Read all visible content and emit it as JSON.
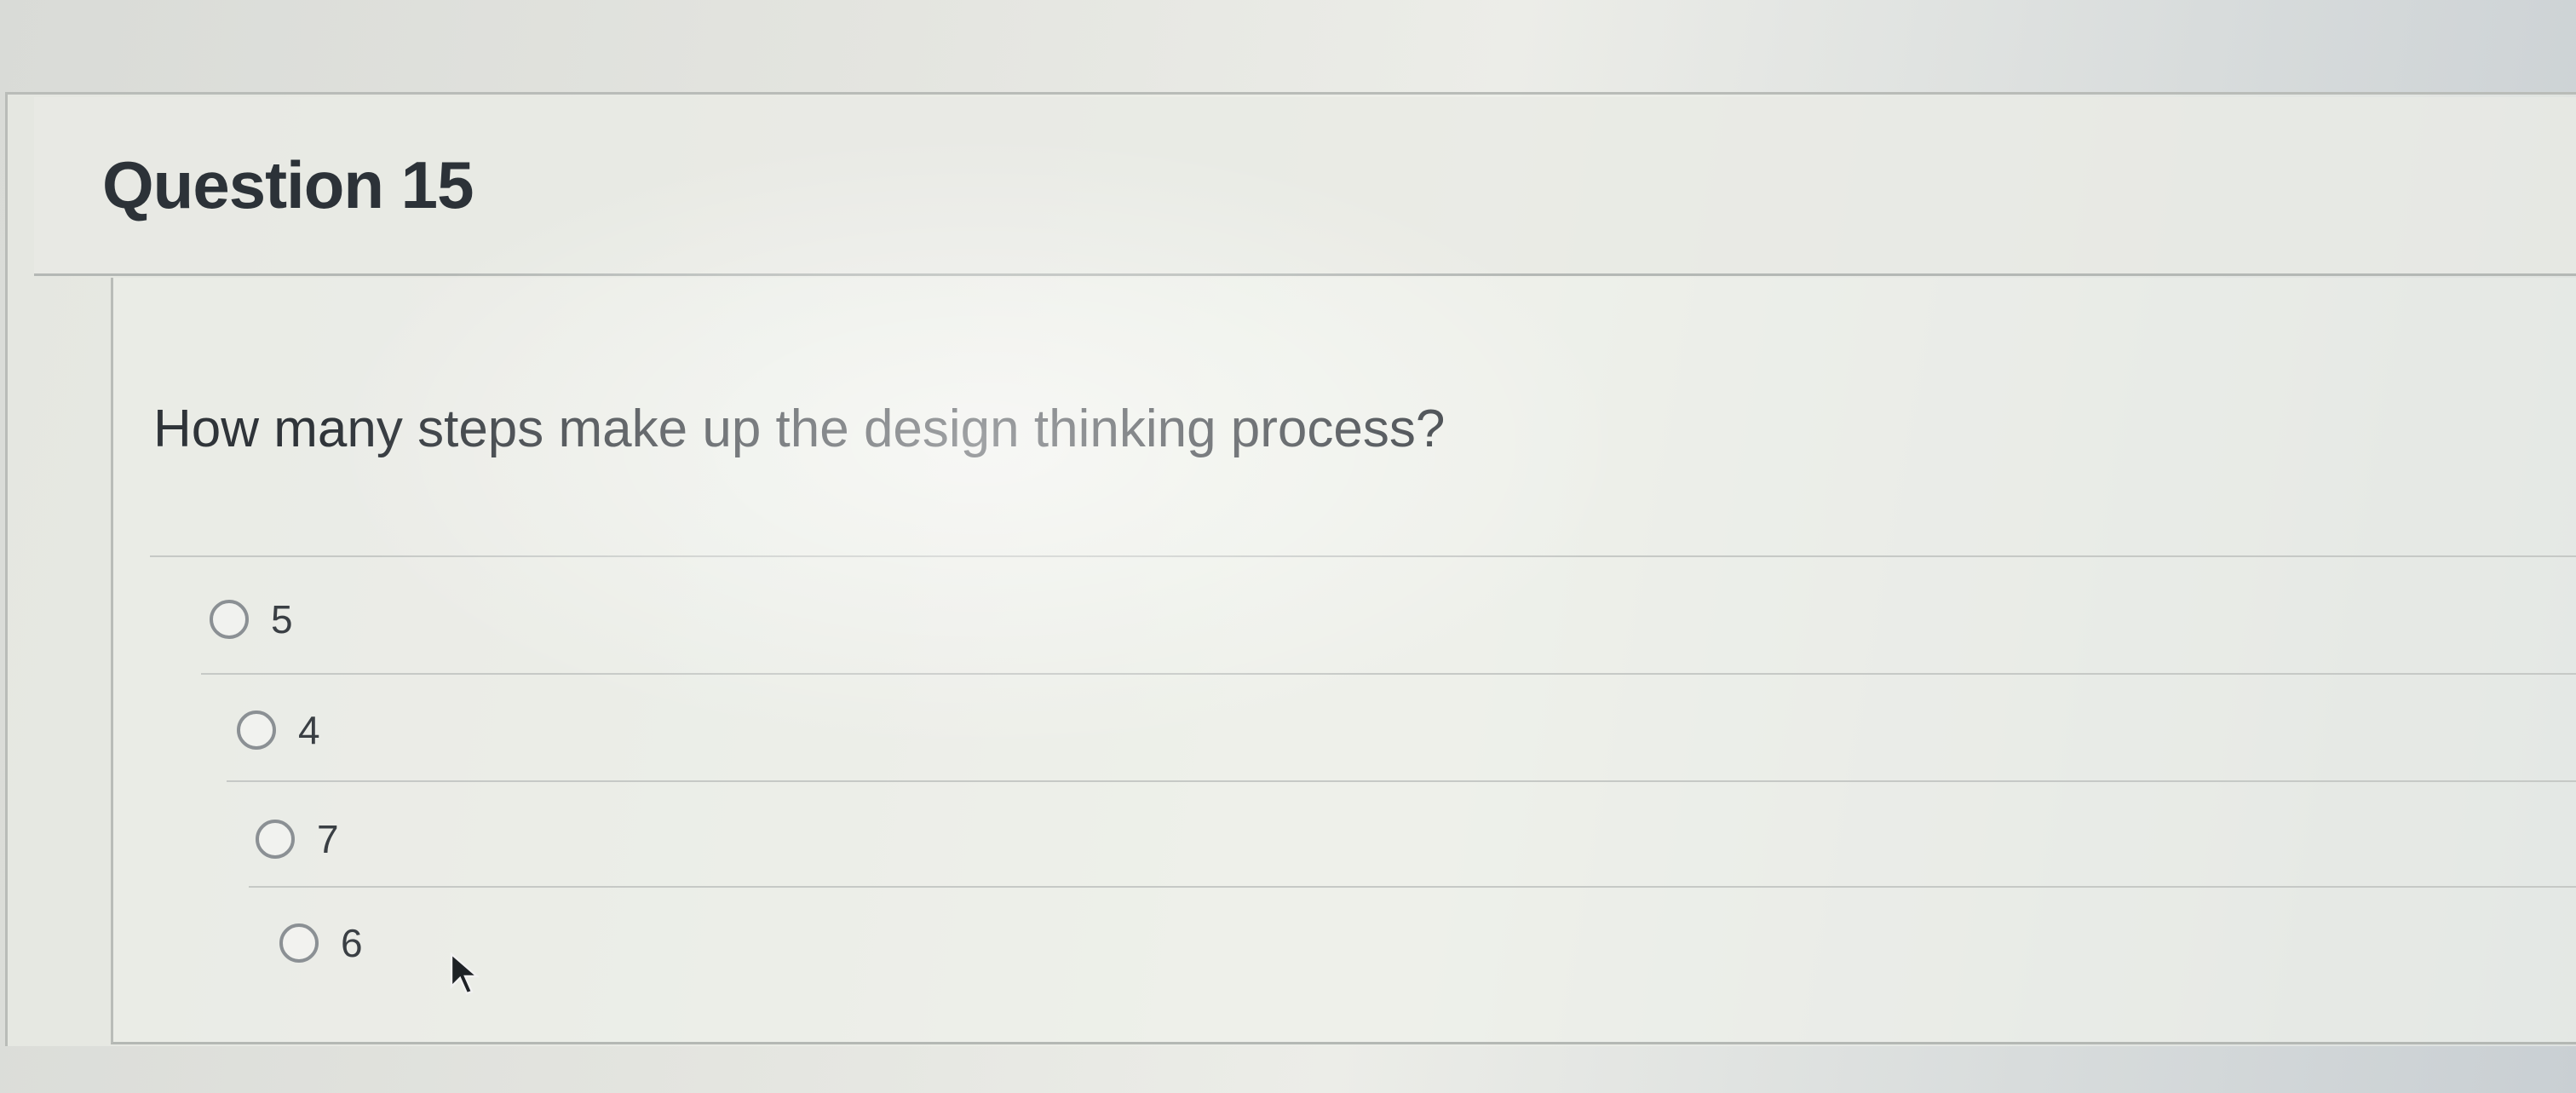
{
  "question": {
    "title": "Question 15",
    "text": "How many steps make up the design thinking process?"
  },
  "answers": [
    {
      "label": "5",
      "selected": false
    },
    {
      "label": "4",
      "selected": false
    },
    {
      "label": "7",
      "selected": false
    },
    {
      "label": "6",
      "selected": false
    }
  ],
  "cursor": {
    "icon": "arrow-cursor-icon"
  }
}
